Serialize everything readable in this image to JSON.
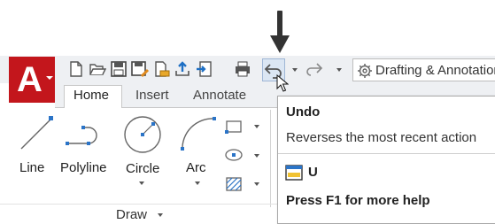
{
  "quick_access": {
    "icons": [
      "new-icon",
      "open-icon",
      "save-icon",
      "save-as-icon",
      "open-from-web-icon",
      "share-icon",
      "plot-icon",
      "undo-icon",
      "redo-icon"
    ],
    "workspace_label": "Drafting & Annotation"
  },
  "tabs": [
    "Home",
    "Insert",
    "Annotate"
  ],
  "active_tab": "Home",
  "draw_panel": {
    "tools": [
      "Line",
      "Polyline",
      "Circle",
      "Arc"
    ],
    "title": "Draw"
  },
  "tooltip": {
    "title": "Undo",
    "description": "Reverses the most recent action",
    "command": "U",
    "help": "Press F1 for more help"
  },
  "colors": {
    "app_button": "#c3161c",
    "accent_blue": "#2b74c7",
    "ribbon_bg": "#eef0f3"
  }
}
